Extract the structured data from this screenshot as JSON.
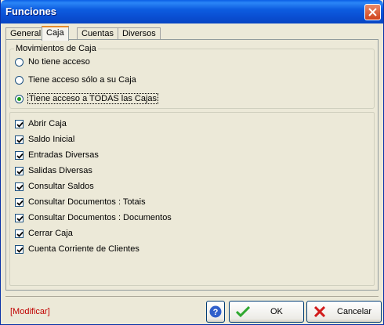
{
  "window": {
    "title": "Funciones"
  },
  "tabs": [
    {
      "label": "General",
      "active": false
    },
    {
      "label": "Caja",
      "active": true
    },
    {
      "label": "Cuentas",
      "active": false
    },
    {
      "label": "Diversos",
      "active": false
    }
  ],
  "movimientos": {
    "group_label": "Movimientos de Caja",
    "options": [
      {
        "label": "No tiene acceso",
        "selected": false
      },
      {
        "label": "Tiene acceso sólo a su Caja",
        "selected": false
      },
      {
        "label": "Tiene acceso a TODAS las Cajas",
        "selected": true
      }
    ]
  },
  "permissions": [
    {
      "label": "Abrir Caja",
      "checked": true
    },
    {
      "label": "Saldo Inicial",
      "checked": true
    },
    {
      "label": "Entradas Diversas",
      "checked": true
    },
    {
      "label": "Salidas Diversas",
      "checked": true
    },
    {
      "label": "Consultar Saldos",
      "checked": true
    },
    {
      "label": "Consultar Documentos : Totais",
      "checked": true
    },
    {
      "label": "Consultar Documentos : Documentos",
      "checked": true
    },
    {
      "label": "Cerrar Caja",
      "checked": true
    },
    {
      "label": "Cuenta Corriente de Clientes",
      "checked": true
    }
  ],
  "footer": {
    "modify_label": "[Modificar]",
    "ok_label": "OK",
    "cancel_label": "Cancelar"
  },
  "icons": {
    "close": "close-icon",
    "help": "help-icon",
    "ok": "checkmark-icon",
    "cancel": "red-x-icon"
  }
}
